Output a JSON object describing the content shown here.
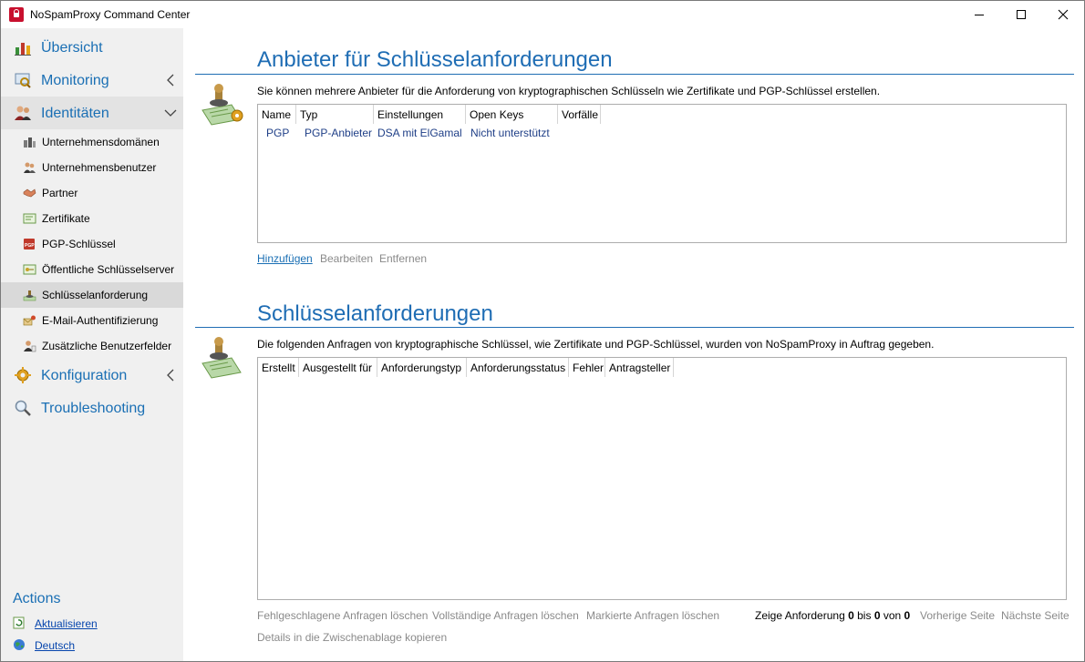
{
  "window": {
    "title": "NoSpamProxy Command Center"
  },
  "sidebar": {
    "top_items": [
      {
        "label": "Übersicht"
      },
      {
        "label": "Monitoring"
      },
      {
        "label": "Identitäten"
      },
      {
        "label": "Konfiguration"
      },
      {
        "label": "Troubleshooting"
      }
    ],
    "sub_items": [
      {
        "label": "Unternehmensdomänen"
      },
      {
        "label": "Unternehmensbenutzer"
      },
      {
        "label": "Partner"
      },
      {
        "label": "Zertifikate"
      },
      {
        "label": "PGP-Schlüssel"
      },
      {
        "label": "Öffentliche Schlüsselserver"
      },
      {
        "label": "Schlüsselanforderung"
      },
      {
        "label": "E-Mail-Authentifizierung"
      },
      {
        "label": "Zusätzliche Benutzerfelder"
      }
    ],
    "actions": {
      "title": "Actions",
      "refresh": "Aktualisieren",
      "language": "Deutsch"
    }
  },
  "providers": {
    "title": "Anbieter für Schlüsselanforderungen",
    "description": "Sie können mehrere Anbieter für die Anforderung von kryptographischen Schlüsseln wie Zertifikate und PGP-Schlüssel erstellen.",
    "columns": [
      "Name",
      "Typ",
      "Einstellungen",
      "Open Keys",
      "Vorfälle"
    ],
    "rows": [
      {
        "name": "PGP",
        "type": "PGP-Anbieter",
        "settings": "DSA mit ElGamal",
        "open_keys": "Nicht unterstützt",
        "incidents": ""
      }
    ],
    "add": "Hinzufügen",
    "edit": "Bearbeiten",
    "remove": "Entfernen"
  },
  "requests": {
    "title": "Schlüsselanforderungen",
    "description": "Die folgenden Anfragen von kryptographische Schlüssel, wie Zertifikate und PGP-Schlüssel, wurden von NoSpamProxy in Auftrag gegeben.",
    "columns": [
      "Erstellt",
      "Ausgestellt für",
      "Anforderungstyp",
      "Anforderungsstatus",
      "Fehler",
      "Antragsteller"
    ],
    "delete_failed": "Fehlgeschlagene Anfragen löschen",
    "delete_complete": "Vollständige Anfragen löschen",
    "delete_selected": "Markierte Anfragen löschen",
    "copy_details": "Details in die Zwischenablage kopieren",
    "pager": {
      "show": "Zeige Anforderung",
      "from": "0",
      "to_word": "bis",
      "to": "0",
      "of_word": "von",
      "total": "0",
      "prev": "Vorherige Seite",
      "next": "Nächste Seite"
    }
  },
  "colors": {
    "accent": "#1f6db4",
    "link_disabled": "#8a8a8a",
    "sidebar_bg": "#f0f0f0"
  }
}
